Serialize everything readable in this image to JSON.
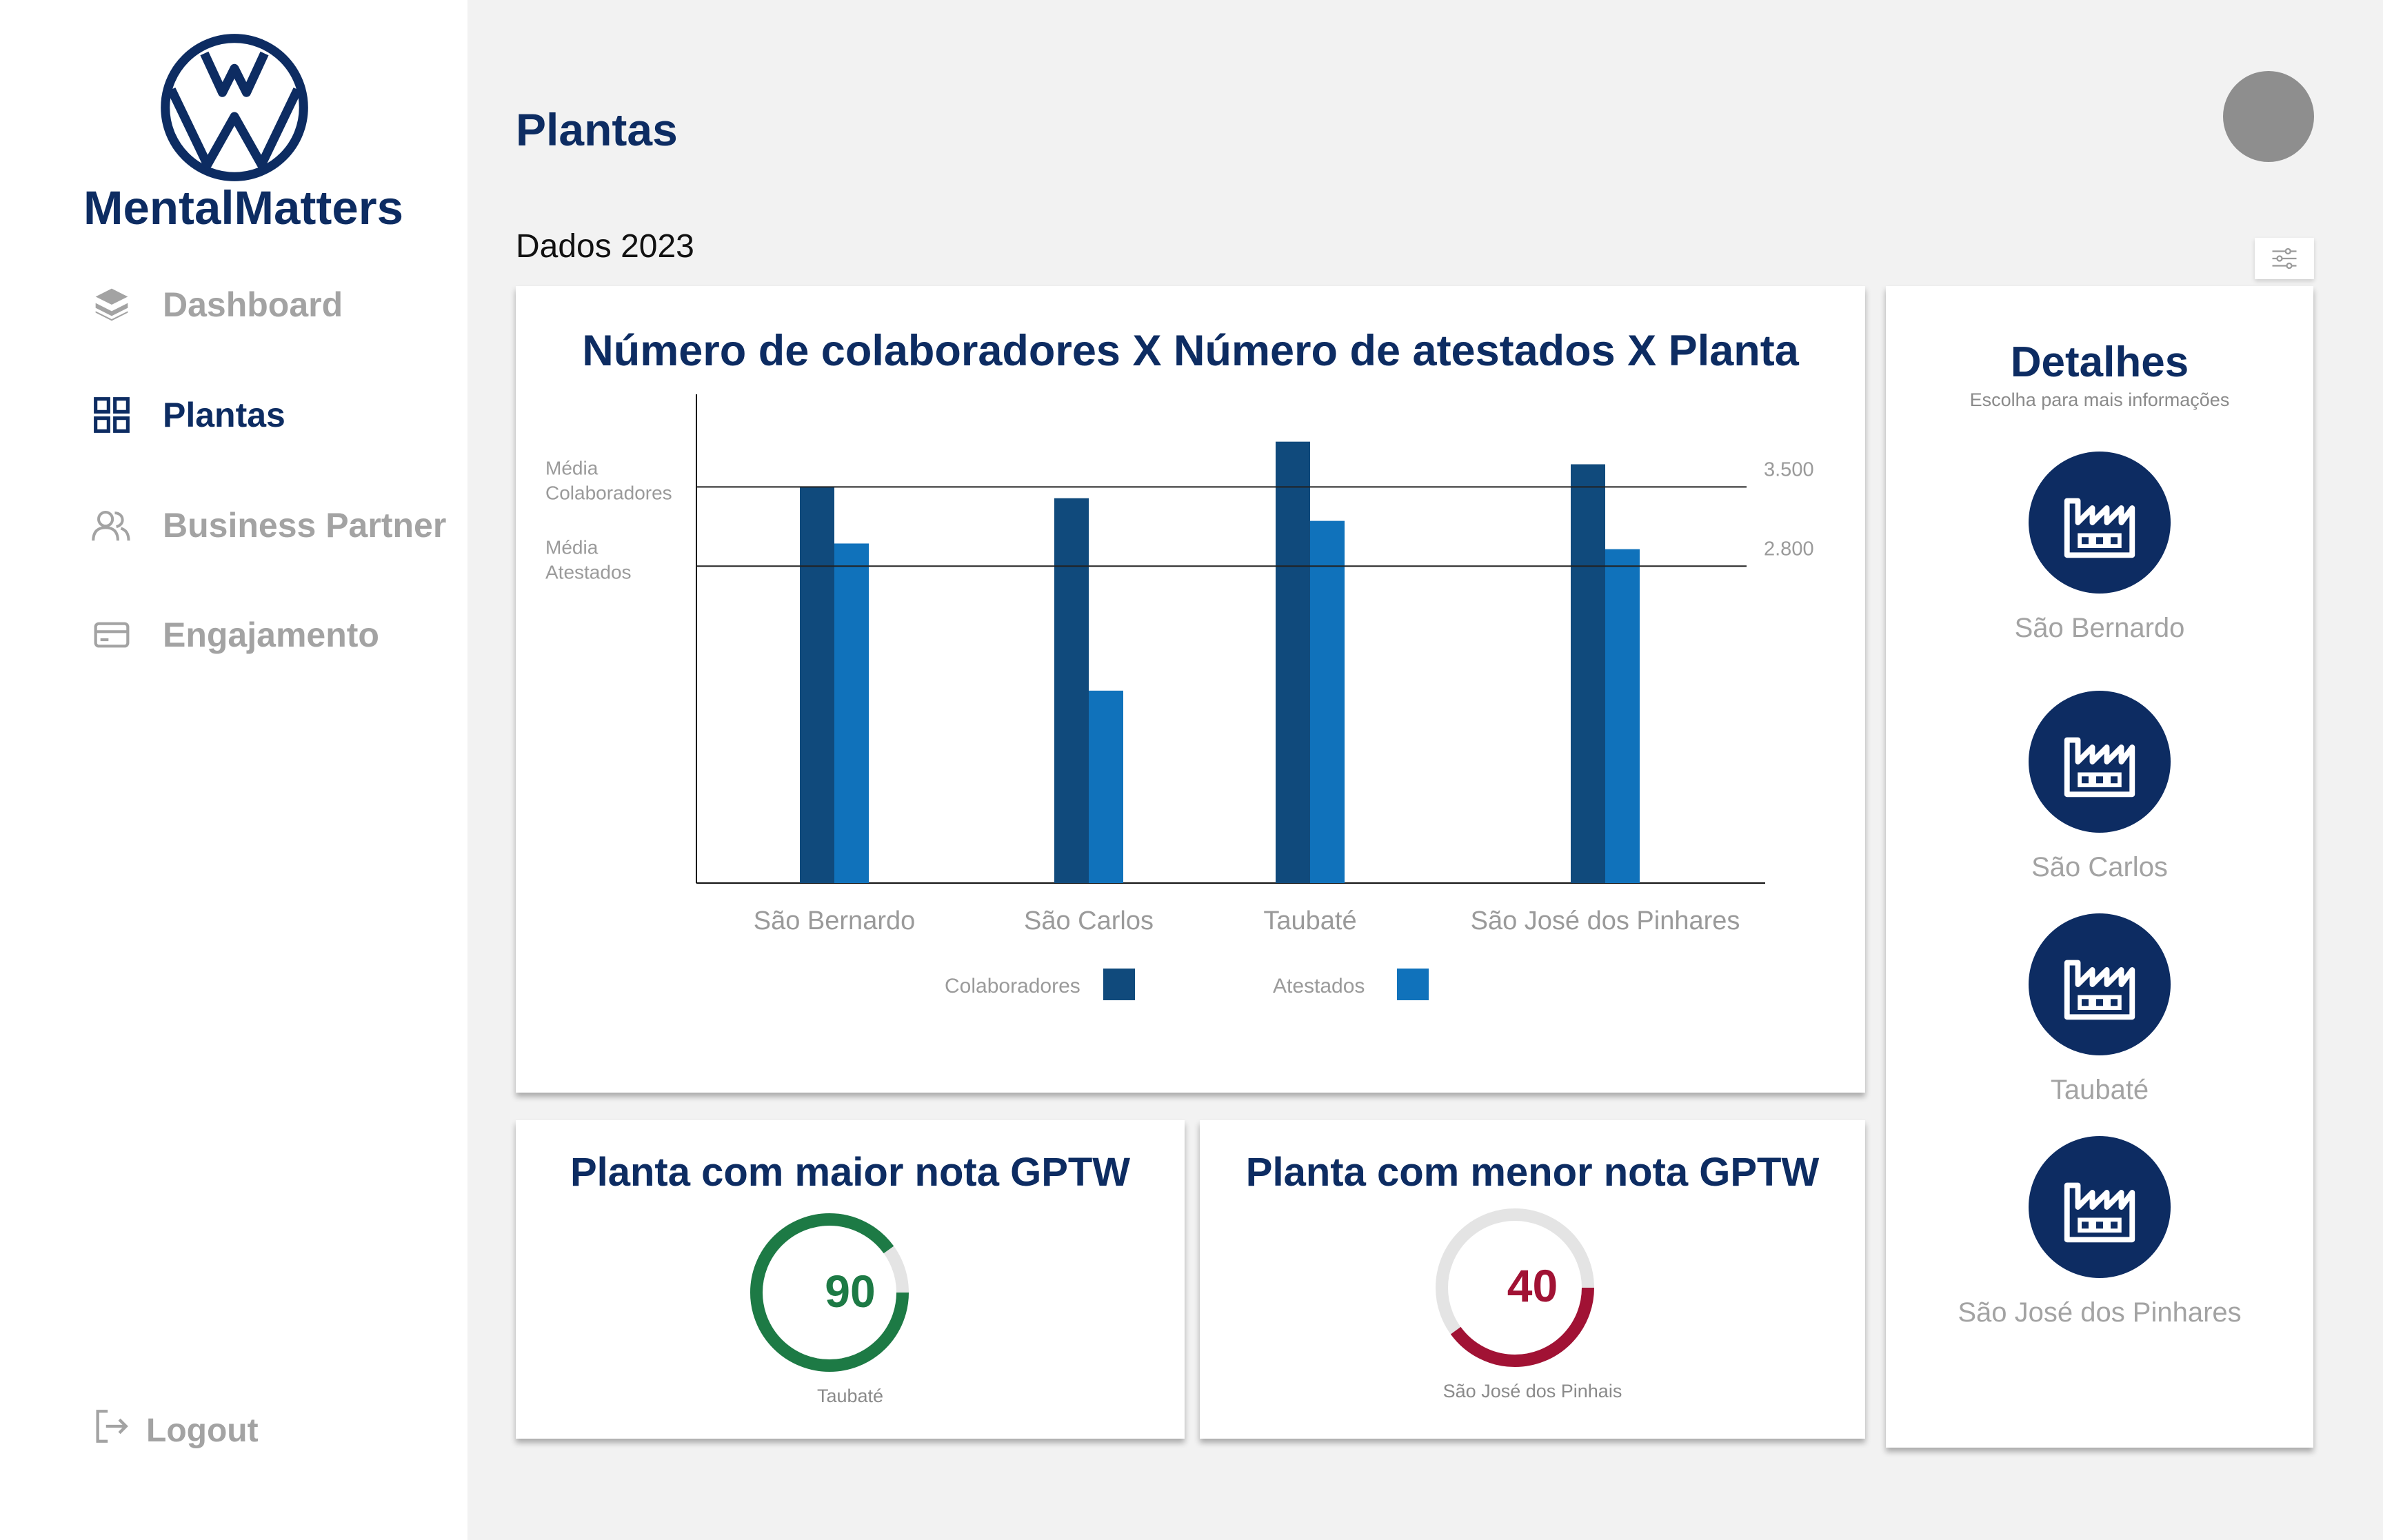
{
  "app": {
    "name": "MentalMatters",
    "logo": "vw-logo"
  },
  "colors": {
    "brand": "#0d2c62",
    "colaboradores": "#104a7c",
    "atestados": "#1072bb",
    "gauge_high": "#1d7a45",
    "gauge_low": "#a11234",
    "muted": "#a3a3a3"
  },
  "sidebar": {
    "items": [
      {
        "label": "Dashboard",
        "icon": "layers-icon",
        "active": false
      },
      {
        "label": "Plantas",
        "icon": "grid-icon",
        "active": true
      },
      {
        "label": "Business Partner",
        "icon": "users-icon",
        "active": false
      },
      {
        "label": "Engajamento",
        "icon": "card-icon",
        "active": false
      }
    ],
    "logout": "Logout"
  },
  "header": {
    "title": "Plantas",
    "subtitle": "Dados 2023"
  },
  "chart_data": {
    "type": "bar",
    "title": "Número de colaboradores X Número de atestados X Planta",
    "categories": [
      "São Bernardo",
      "São Carlos",
      "Taubaté",
      "São José dos Pinhares"
    ],
    "series": [
      {
        "name": "Colaboradores",
        "values": [
          3500,
          3400,
          3900,
          3700
        ]
      },
      {
        "name": "Atestados",
        "values": [
          3000,
          1700,
          3200,
          2950
        ]
      }
    ],
    "reference_lines": [
      {
        "label": "Média Colaboradores",
        "value": 3500,
        "value_label": "3.500"
      },
      {
        "label": "Média Atestados",
        "value": 2800,
        "value_label": "2.800"
      }
    ],
    "ylim": [
      0,
      4300
    ],
    "grid": false,
    "legend": "bottom"
  },
  "gptw": {
    "best": {
      "title": "Planta com maior nota GPTW",
      "value": "90",
      "percent": 90,
      "plant": "Taubaté"
    },
    "worst": {
      "title": "Planta com menor nota GPTW",
      "value": "40",
      "percent": 40,
      "plant": "São José dos Pinhais"
    }
  },
  "details": {
    "title": "Detalhes",
    "subtitle": "Escolha para mais informações",
    "plants": [
      {
        "name": "São Bernardo",
        "icon": "factory-icon"
      },
      {
        "name": "São Carlos",
        "icon": "factory-icon"
      },
      {
        "name": "Taubaté",
        "icon": "factory-icon"
      },
      {
        "name": "São José dos Pinhares",
        "icon": "factory-icon"
      }
    ]
  }
}
